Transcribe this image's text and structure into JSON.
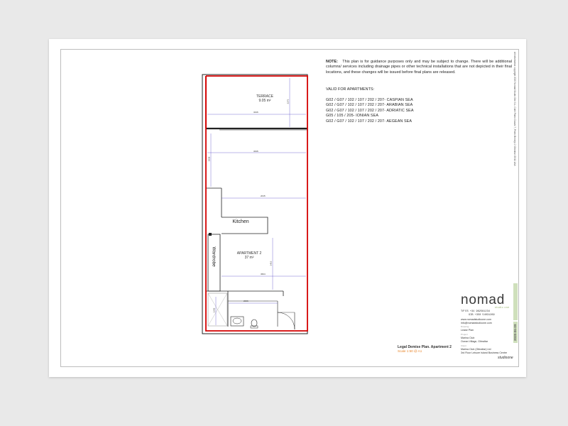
{
  "note": {
    "label": "NOTE:",
    "text": "This plan is for guidance purposes only and may be subject to change. There will be additional columns/ services including drainage pipes or other technical installations that are not depicted in their final locations, and these changes will be issued before final plans are released."
  },
  "valid_heading": "VALID FOR APARTMENTS:",
  "apartments": [
    "G02 / G07 / 102 / 107 / 202 / 207- CASPIAN SEA",
    "G02 / G07 / 102 / 107 / 202 / 207- ARABIAN SEA",
    "G02 / G07 / 102 / 107 / 202 / 207- ADRIATIC SEA",
    "G05 / 105 / 205-  IONIAN SEA",
    "G02 / G07 / 102 / 107 / 202 / 207- AEGEAN SEA"
  ],
  "rooms": {
    "terrace_name": "TERRACE",
    "terrace_area": "9.05 m²",
    "kitchen": "Kitchen",
    "wardrobe": "Wardrobe",
    "apartment_name": "APARTMENT 2",
    "apartment_area": "37 m²"
  },
  "dims": {
    "d_terrace_w": "3446",
    "d_terrace_h": "2273",
    "d_main_w": "3446",
    "d_left_h": "1838",
    "d_kitchen_w": "2015",
    "d_apt_w": "3604",
    "d_bath_w": "2066",
    "d_bath_h": "1246",
    "d_apt_h": "3416"
  },
  "legend": {
    "title": "Legal Demise Plan. Apartment 2",
    "scale": "Scale 1:50 @ A1"
  },
  "titleblock": {
    "logo": "nomad",
    "logo_sub": "studio one",
    "phone_label_tf": "T/F",
    "phone_es": "ES    +34 962561234",
    "phone_gib": "GIB   +350 54031269",
    "web": "www.nomadstudioone.com",
    "email": "info@nomadstudioone.com",
    "drawing_label": "Drawing",
    "drawing": "Lease Plan",
    "project_label": "Project",
    "project_1": "Marina Club",
    "project_2": "Ocean Village, Gibraltar",
    "client_label": "Client",
    "client_1": "Marina Club (Gibraltar) Ltd",
    "client_2": "3rd Floor Leisure Island Business Centre",
    "date_tab": "2020-06-09",
    "right_strip": "All information copyright 2020 Nomad Studio One S.L. Calle Pablo Casals 7, Pedro Bernejo 2 Gibraltar GX11 1AA",
    "signature": "studioone"
  },
  "colors": {
    "demise_red": "#d40000",
    "wall": "#222222",
    "dim_line": "#5a4dc7",
    "accent_orange": "#e8862c",
    "accent_green": "#8fae63"
  }
}
